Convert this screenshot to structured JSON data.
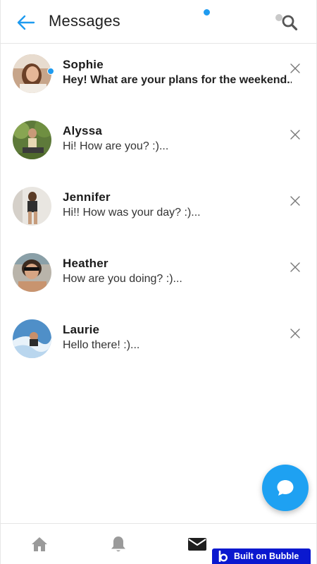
{
  "header": {
    "title": "Messages",
    "back_icon": "arrow-left-icon",
    "search_icon": "search-icon"
  },
  "conversations": [
    {
      "name": "Sophie",
      "preview": "Hey! What are your plans for the weekend...",
      "unread": true,
      "online": true,
      "avatar_icon": "avatar-photo"
    },
    {
      "name": "Alyssa",
      "preview": "Hi! How are you?  :)...",
      "unread": false,
      "online": false,
      "avatar_icon": "avatar-photo"
    },
    {
      "name": "Jennifer",
      "preview": "Hi!! How was your day?  :)...",
      "unread": false,
      "online": false,
      "avatar_icon": "avatar-photo"
    },
    {
      "name": "Heather",
      "preview": "How are you doing? :)...",
      "unread": false,
      "online": false,
      "avatar_icon": "avatar-photo"
    },
    {
      "name": "Laurie",
      "preview": "Hello there! :)...",
      "unread": false,
      "online": false,
      "avatar_icon": "avatar-photo"
    }
  ],
  "fab": {
    "icon": "chat-bubble-icon"
  },
  "bottom_nav": {
    "items": [
      {
        "icon": "home-icon",
        "active": false
      },
      {
        "icon": "bell-icon",
        "active": false
      },
      {
        "icon": "mail-icon",
        "active": true,
        "badge": true
      },
      {
        "icon": "profile-icon",
        "active": false
      }
    ]
  },
  "badge": {
    "text": "Built on Bubble",
    "icon": "bubble-logo-icon"
  },
  "colors": {
    "accent": "#1ea1f2",
    "badge_bg": "#0a18cf",
    "text_dark": "#1b1b1b",
    "icon_gray": "#9a9a9a"
  }
}
